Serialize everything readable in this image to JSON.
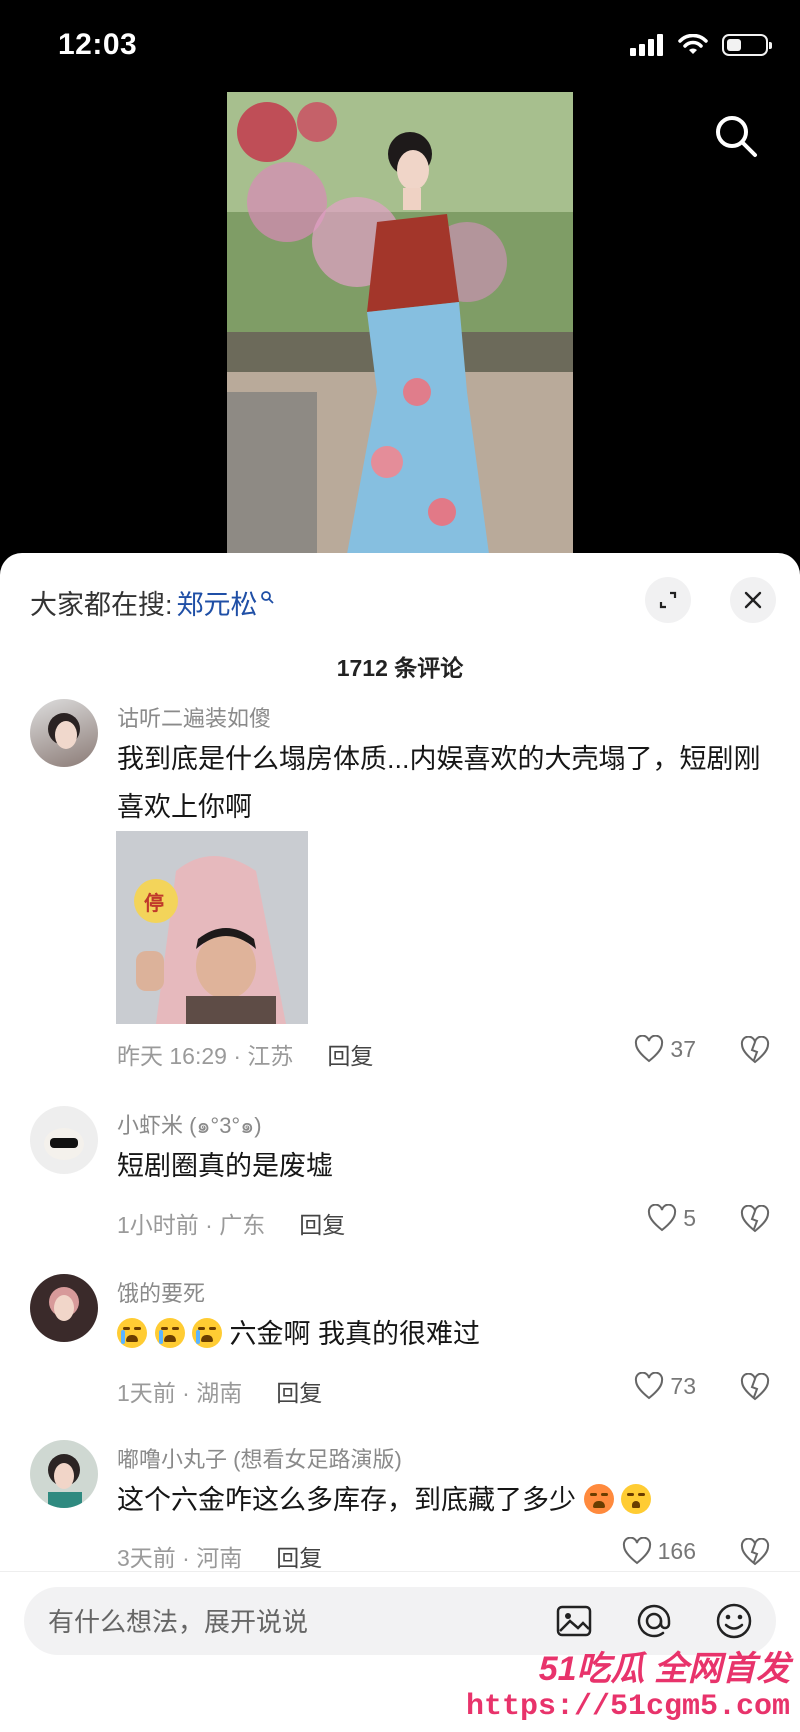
{
  "status_bar": {
    "time": "12:03"
  },
  "sheet": {
    "trend_prefix": "大家都在搜:",
    "trend_keyword": "郑元松",
    "comment_count": "1712 条评论"
  },
  "comments": [
    {
      "user": "诂听二遍装如傻",
      "text": "我到底是什么塌房体质...内娱喜欢的大壳塌了，短剧刚喜欢上你啊",
      "time_loc": "昨天 16:29 · 江苏",
      "reply": "回复",
      "likes": "37",
      "image_sign_text": "停"
    },
    {
      "user": "小虾米 (๑°3°๑)",
      "text": "短剧圈真的是废墟",
      "time_loc": "1小时前 · 广东",
      "reply": "回复",
      "likes": "5"
    },
    {
      "user": "饿的要死",
      "text": "六金啊 我真的很难过",
      "time_loc": "1天前 · 湖南",
      "reply": "回复",
      "likes": "73"
    },
    {
      "user": "嘟噜小丸子 (想看女足路演版)",
      "text": "这个六金咋这么多库存，到底藏了多少",
      "time_loc": "3天前 · 河南",
      "reply": "回复",
      "likes": "166"
    }
  ],
  "input": {
    "placeholder": "有什么想法，展开说说"
  },
  "watermark": {
    "brand": "51吃瓜 全网首发",
    "url": "https://51cgm5.com"
  },
  "colors": {
    "keyword": "#1f4fa6",
    "sheet_bg": "#ffffff",
    "watermark": "#e8336b"
  }
}
